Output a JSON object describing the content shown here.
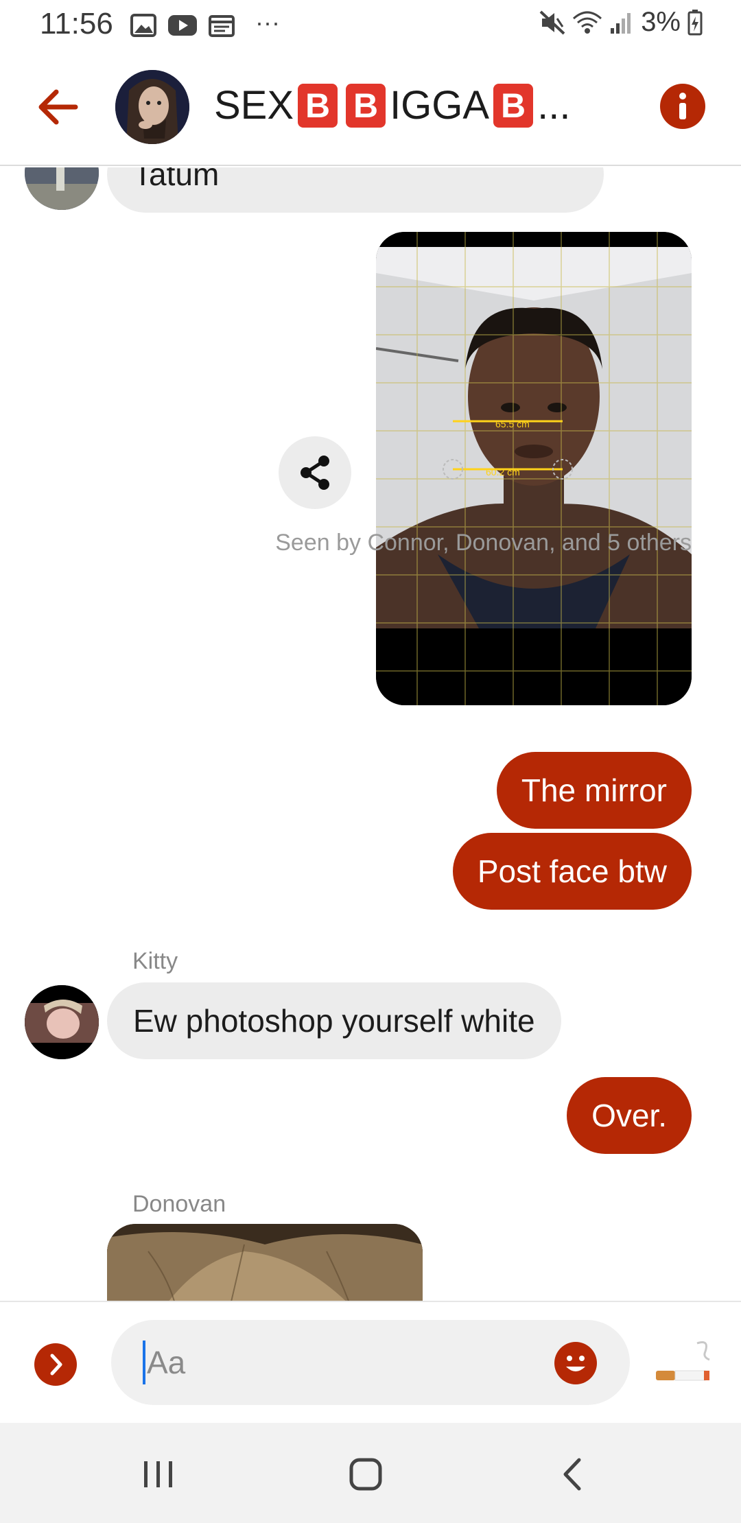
{
  "status_bar": {
    "time": "11:56",
    "battery": "3%",
    "more": "···"
  },
  "header": {
    "title_prefix": "SEX",
    "title_middle": "IGGA",
    "title_suffix": "...",
    "title_emoji": "B"
  },
  "messages": {
    "tatum_text": "Tatum",
    "seen": "Seen by Connor, Donovan, and 5 others",
    "out_1": "The mirror",
    "out_2": "Post face btw",
    "kitty_name": "Kitty",
    "kitty_text": "Ew photoshop yourself white",
    "out_3": "Over.",
    "donovan_name": "Donovan"
  },
  "photo_labels": {
    "measure_1": "65.5 cm",
    "measure_2": "60.2 cm"
  },
  "composer": {
    "placeholder": "Aa"
  },
  "colors": {
    "accent": "#b52805",
    "incoming_bubble": "#ececec"
  }
}
